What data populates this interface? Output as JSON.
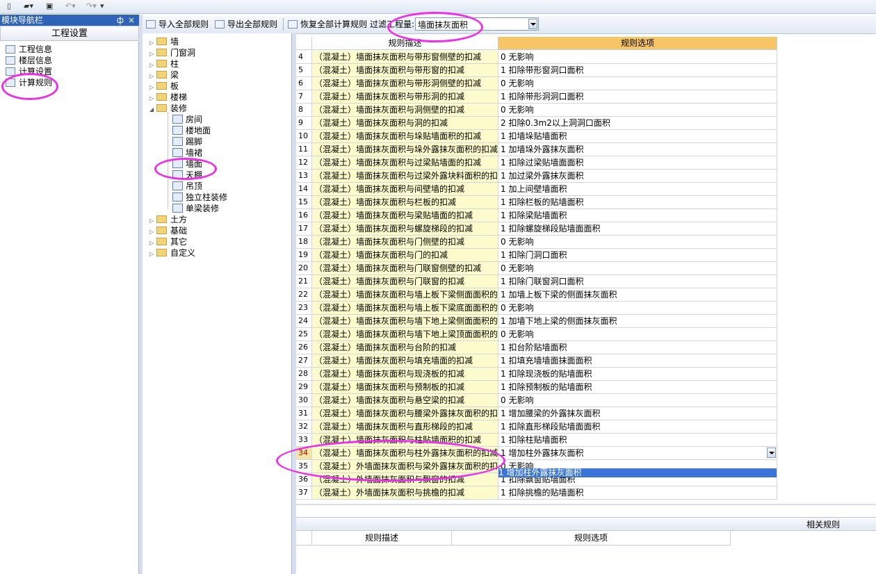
{
  "nav": {
    "title": "模块导航栏",
    "pin": "ф",
    "close": "×",
    "group": "工程设置",
    "items": [
      "工程信息",
      "楼层信息",
      "计算设置",
      "计算规则"
    ]
  },
  "toolbar": {
    "import_label": "导入全部规则",
    "export_label": "导出全部规则",
    "restore_label": "恢复全部计算规则",
    "filter_label": "过滤工程量:",
    "filter_value": "墙面抹灰面积"
  },
  "tree": {
    "top": [
      "墙",
      "门窗洞",
      "柱",
      "梁",
      "板",
      "楼梯"
    ],
    "decor": "装修",
    "decor_children": [
      "房间",
      "楼地面",
      "踢脚",
      "墙裙",
      "墙面",
      "天棚",
      "吊顶",
      "独立柱装修",
      "单梁装修"
    ],
    "bottom": [
      "土方",
      "基础",
      "其它",
      "自定义"
    ]
  },
  "grid": {
    "headers": [
      "规则描述",
      "规则选项"
    ],
    "rows": [
      {
        "n": "4",
        "d": "（混凝土）墙面抹灰面积与带形窗侧壁的扣减",
        "o": "0  无影响"
      },
      {
        "n": "5",
        "d": "（混凝土）墙面抹灰面积与带形窗的扣减",
        "o": "1 扣除带形窗洞口面积"
      },
      {
        "n": "6",
        "d": "（混凝土）墙面抹灰面积与带形洞侧壁的扣减",
        "o": "0  无影响"
      },
      {
        "n": "7",
        "d": "（混凝土）墙面抹灰面积与带形洞的扣减",
        "o": "1 扣除带形洞洞口面积"
      },
      {
        "n": "8",
        "d": "（混凝土）墙面抹灰面积与洞侧壁的扣减",
        "o": "0  无影响"
      },
      {
        "n": "9",
        "d": "（混凝土）墙面抹灰面积与洞的扣减",
        "o": "2 扣除0.3m2以上洞洞口面积"
      },
      {
        "n": "10",
        "d": "（混凝土）墙面抹灰面积与垛贴墙面积的扣减",
        "o": "1 扣墙垛贴墙面积"
      },
      {
        "n": "11",
        "d": "（混凝土）墙面抹灰面积与垛外露抹灰面积的扣减",
        "o": "1 加墙垛外露抹灰面积"
      },
      {
        "n": "12",
        "d": "（混凝土）墙面抹灰面积与过梁贴墙面的扣减",
        "o": "1 扣除过梁贴墙面面积"
      },
      {
        "n": "13",
        "d": "（混凝土）墙面抹灰面积与过梁外露块料面积的扣",
        "o": "1 加过梁外露抹灰面积"
      },
      {
        "n": "14",
        "d": "（混凝土）墙面抹灰面积与间壁墙的扣减",
        "o": "1 加上间壁墙面积"
      },
      {
        "n": "15",
        "d": "（混凝土）墙面抹灰面积与栏板的扣减",
        "o": "1 扣除栏板的贴墙面积"
      },
      {
        "n": "16",
        "d": "（混凝土）墙面抹灰面积与梁贴墙面的扣减",
        "o": "1 扣除梁贴墙面积"
      },
      {
        "n": "17",
        "d": "（混凝土）墙面抹灰面积与螺旋梯段的扣减",
        "o": "1 扣除螺旋梯段贴墙面面积"
      },
      {
        "n": "18",
        "d": "（混凝土）墙面抹灰面积与门侧壁的扣减",
        "o": "0  无影响"
      },
      {
        "n": "19",
        "d": "（混凝土）墙面抹灰面积与门的扣减",
        "o": "1 扣除门洞口面积"
      },
      {
        "n": "20",
        "d": "（混凝土）墙面抹灰面积与门联窗侧壁的扣减",
        "o": "0  无影响"
      },
      {
        "n": "21",
        "d": "（混凝土）墙面抹灰面积与门联窗的扣减",
        "o": "1 扣除门联窗洞口面积"
      },
      {
        "n": "22",
        "d": "（混凝土）墙面抹灰面积与墙上板下梁侧面面积的",
        "o": "1 加墙上板下梁的侧面抹灰面积"
      },
      {
        "n": "23",
        "d": "（混凝土）墙面抹灰面积与墙上板下梁底面面积的",
        "o": "0  无影响"
      },
      {
        "n": "24",
        "d": "（混凝土）墙面抹灰面积与墙下地上梁侧面面积的",
        "o": "1 加墙下地上梁的侧面抹灰面积"
      },
      {
        "n": "25",
        "d": "（混凝土）墙面抹灰面积与墙下地上梁顶面面积的",
        "o": "0  无影响"
      },
      {
        "n": "26",
        "d": "（混凝土）墙面抹灰面积与台阶的扣减",
        "o": "1 扣台阶贴墙面积"
      },
      {
        "n": "27",
        "d": "（混凝土）墙面抹灰面积与填充墙面的扣减",
        "o": "1 扣填充墙墙面抹面面积"
      },
      {
        "n": "28",
        "d": "（混凝土）墙面抹灰面积与现浇板的扣减",
        "o": "1 扣除现浇板的贴墙面积"
      },
      {
        "n": "29",
        "d": "（混凝土）墙面抹灰面积与预制板的扣减",
        "o": "1 扣除预制板的贴墙面积"
      },
      {
        "n": "30",
        "d": "（混凝土）墙面抹灰面积与悬空梁的扣减",
        "o": "0  无影响"
      },
      {
        "n": "31",
        "d": "（混凝土）墙面抹灰面积与腰梁外露抹灰面积的扣",
        "o": "1 增加腰梁的外露抹灰面积"
      },
      {
        "n": "32",
        "d": "（混凝土）墙面抹灰面积与直形梯段的扣减",
        "o": "1 扣除直形梯段贴墙面面积"
      },
      {
        "n": "33",
        "d": "（混凝土）墙面抹灰面积与柱贴墙面积的扣减",
        "o": "1 扣除柱贴墙面积"
      },
      {
        "n": "34",
        "d": "（混凝土）墙面抹灰面积与柱外露抹灰面积的扣减",
        "o": "1 增加柱外露抹灰面积"
      },
      {
        "n": "35",
        "d": "（混凝土）外墙面抹灰面积与梁外露抹灰面积的扣",
        "o": "0  无影响"
      },
      {
        "n": "36",
        "d": "（混凝土）外墙面抹灰面积与飘窗的扣减",
        "o": "1 扣除飘窗贴墙面积"
      },
      {
        "n": "37",
        "d": "（混凝土）外墙面抹灰面积与挑檐的扣减",
        "o": "1 扣除挑檐的贴墙面积"
      }
    ],
    "dropdown_option": "1 增加柱外露抹灰面积"
  },
  "related": {
    "title": "相关规则",
    "headers": [
      "规则描述",
      "规则选项"
    ]
  },
  "colors": {
    "highlight": "#ee2ee8",
    "header_selected": "#f7c466",
    "desc_bg": "#fbfbcc",
    "nav_title_bg": "#2f63b8"
  }
}
